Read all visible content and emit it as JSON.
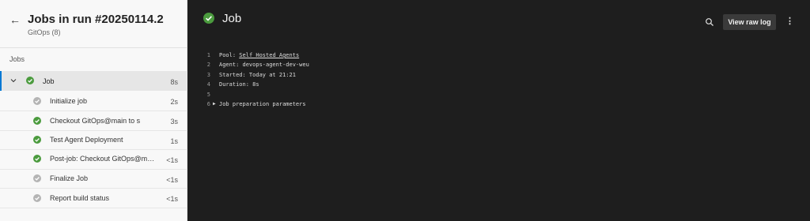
{
  "sidebar": {
    "run_title": "Jobs in run #20250114.2",
    "run_subtitle": "GitOps (8)",
    "section_label": "Jobs",
    "job": {
      "name": "Job",
      "duration": "8s",
      "status": "succeeded"
    },
    "steps": [
      {
        "label": "Initialize job",
        "duration": "2s",
        "status": "skipped"
      },
      {
        "label": "Checkout GitOps@main to s",
        "duration": "3s",
        "status": "succeeded"
      },
      {
        "label": "Test Agent Deployment",
        "duration": "1s",
        "status": "succeeded"
      },
      {
        "label": "Post-job: Checkout GitOps@mai…",
        "duration": "<1s",
        "status": "succeeded"
      },
      {
        "label": "Finalize Job",
        "duration": "<1s",
        "status": "skipped"
      },
      {
        "label": "Report build status",
        "duration": "<1s",
        "status": "skipped"
      }
    ]
  },
  "main": {
    "title": "Job",
    "view_raw_log_label": "View raw log",
    "more_label": "⋮",
    "log": [
      {
        "num": "1",
        "prefix": "Pool: ",
        "link": "Self Hosted Agents",
        "text": ""
      },
      {
        "num": "2",
        "prefix": "",
        "link": "",
        "text": "Agent: devops-agent-dev-weu"
      },
      {
        "num": "3",
        "prefix": "",
        "link": "",
        "text": "Started: Today at 21:21"
      },
      {
        "num": "4",
        "prefix": "",
        "link": "",
        "text": "Duration: 8s"
      },
      {
        "num": "5",
        "prefix": "",
        "link": "",
        "text": ""
      },
      {
        "num": "6",
        "prefix": "",
        "link": "",
        "text": "Job preparation parameters",
        "expander": "▶"
      }
    ]
  },
  "colors": {
    "success": "#4b9b3e",
    "skipped": "#b4b4b4",
    "accent": "#0078d4",
    "log_bg": "#1e1e1e"
  },
  "icons": {
    "back": "arrow-left-icon",
    "search": "search-icon",
    "more": "more-vertical-icon",
    "chevron": "chevron-down-icon",
    "success": "check-circle-icon",
    "skipped": "skipped-circle-icon"
  }
}
